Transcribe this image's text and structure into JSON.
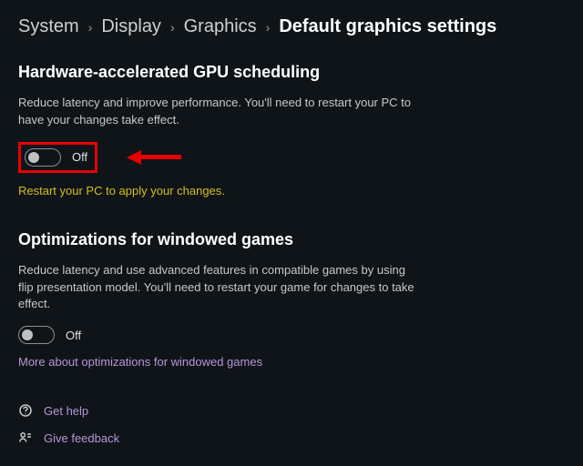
{
  "breadcrumb": {
    "items": [
      "System",
      "Display",
      "Graphics"
    ],
    "current": "Default graphics settings",
    "separator": "›"
  },
  "section1": {
    "title": "Hardware-accelerated GPU scheduling",
    "description": "Reduce latency and improve performance. You'll need to restart your PC to have your changes take effect.",
    "toggle_state": "Off",
    "restart_note": "Restart your PC to apply your changes."
  },
  "section2": {
    "title": "Optimizations for windowed games",
    "description": "Reduce latency and use advanced features in compatible games by using flip presentation model. You'll need to restart your game for changes to take effect.",
    "toggle_state": "Off",
    "link": "More about optimizations for windowed games"
  },
  "footer": {
    "help": "Get help",
    "feedback": "Give feedback"
  },
  "colors": {
    "bg": "#0f1419",
    "accent": "#b896d8",
    "highlight": "#e60000",
    "warning": "#d0c020"
  }
}
